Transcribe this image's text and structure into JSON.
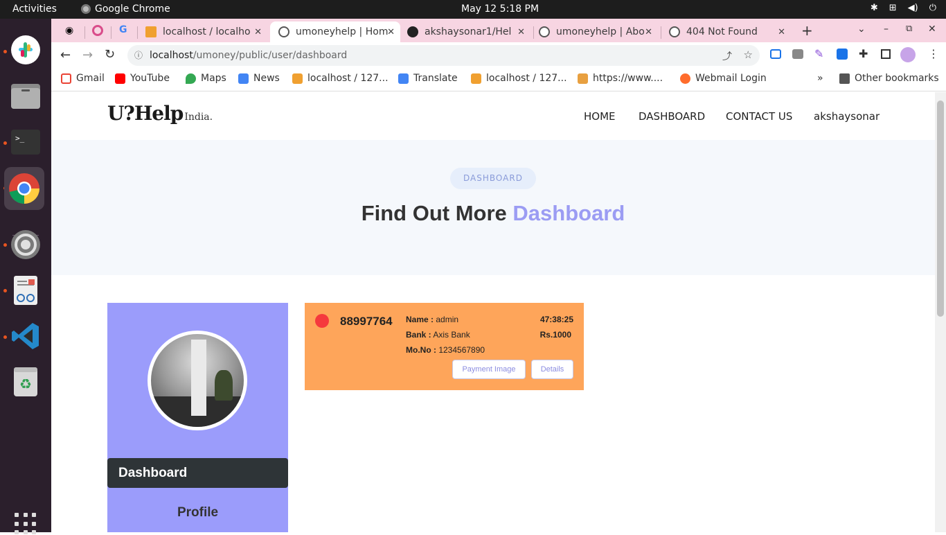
{
  "system": {
    "activities": "Activities",
    "app_name": "Google Chrome",
    "clock": "May 12  5:18 PM"
  },
  "browser": {
    "tabs": [
      {
        "label": "localhost / localho",
        "active": false
      },
      {
        "label": "umoneyhelp | Hom",
        "active": true
      },
      {
        "label": "akshaysonar1/Hel",
        "active": false
      },
      {
        "label": "umoneyhelp | Abo",
        "active": false
      },
      {
        "label": "404 Not Found",
        "active": false
      }
    ],
    "url_host": "localhost",
    "url_path": "/umoney/public/user/dashboard",
    "bookmarks": [
      "Gmail",
      "YouTube",
      "Maps",
      "News",
      "localhost / 127...",
      "Translate",
      "localhost / 127...",
      "https://www....",
      "Webmail Login"
    ],
    "overflow": "»",
    "other_bookmarks": "Other bookmarks"
  },
  "site": {
    "logo_main": "U?Help",
    "logo_sub": "India.",
    "nav": [
      "HOME",
      "DASHBOARD",
      "CONTACT US",
      "akshaysonar"
    ]
  },
  "hero": {
    "pill": "DASHBOARD",
    "title_plain": "Find Out More ",
    "title_accent": "Dashboard"
  },
  "sidebar": {
    "dashboard": "Dashboard",
    "profile": "Profile"
  },
  "card": {
    "number": "88997764",
    "name_label": "Name :",
    "name_value": " admin",
    "bank_label": "Bank :",
    "bank_value": " Axis Bank",
    "mono_label": "Mo.No :",
    "mono_value": " 1234567890",
    "time": "47:38:25",
    "amount": "Rs.1000",
    "payment_image_button": "Payment Image",
    "details_button": "Details"
  },
  "colors": {
    "hero_accent": "#9b9cf3",
    "sidebar_bg": "#9b9cfb",
    "card_bg": "#fea55a",
    "status_dot": "#f5393d"
  }
}
